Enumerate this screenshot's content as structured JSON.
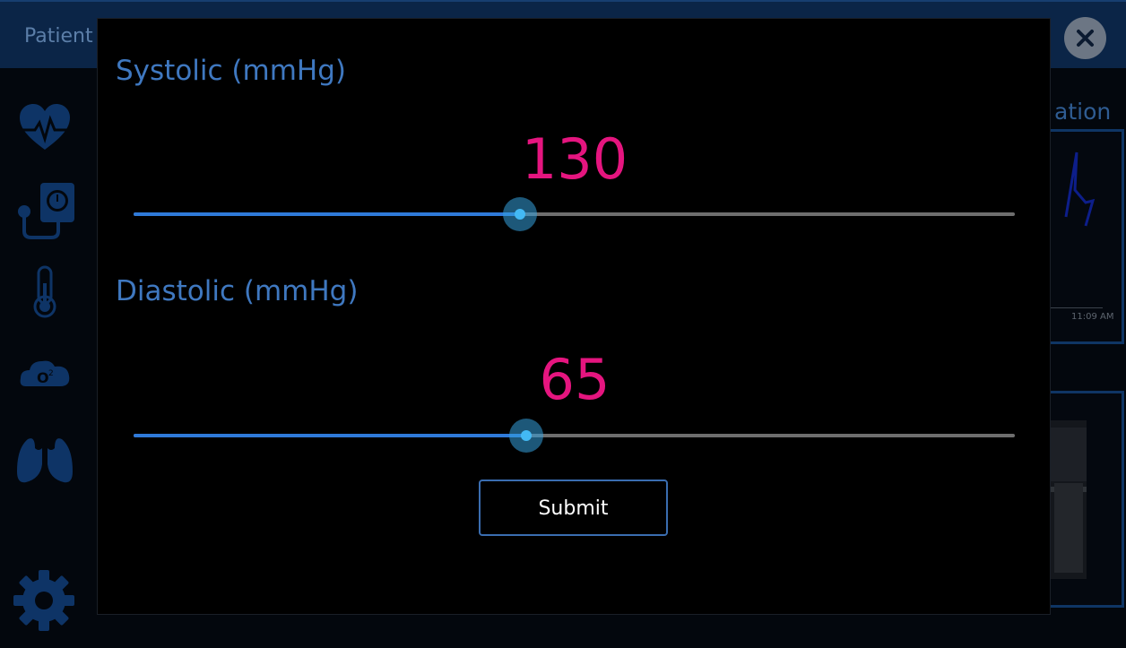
{
  "header": {
    "title_visible": "Patient",
    "close_icon": "close-icon"
  },
  "sidebar": {
    "icons": [
      "heart-pulse-icon",
      "blood-pressure-icon",
      "thermometer-icon",
      "oxygen-icon",
      "lungs-icon",
      "gear-icon"
    ]
  },
  "right_panel": {
    "title_visible": "ation",
    "chart_time_label": "11:09 AM"
  },
  "dialog": {
    "systolic": {
      "label": "Systolic (mmHg)",
      "value": "130",
      "slider_fraction": 0.438
    },
    "diastolic": {
      "label": "Diastolic (mmHg)",
      "value": "65",
      "slider_fraction": 0.446
    },
    "submit_label": "Submit"
  },
  "colors": {
    "accent_blue": "#3f78c0",
    "value_pink": "#e5157f",
    "slider_fill": "#2f7ad9",
    "slider_thumb": "#43b9f4"
  }
}
